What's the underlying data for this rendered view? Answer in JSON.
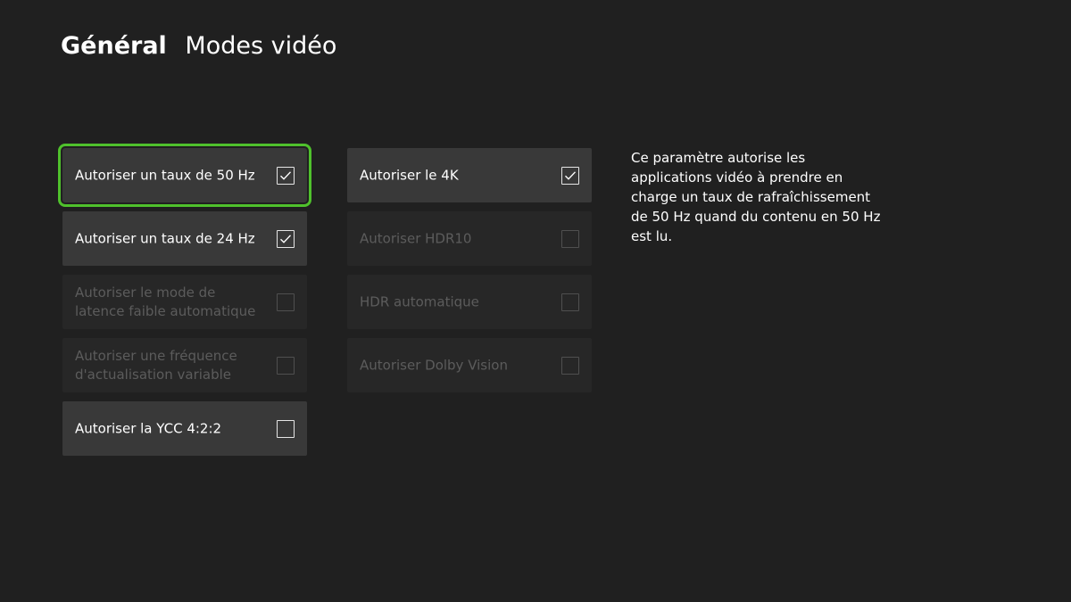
{
  "header": {
    "section": "Général",
    "page_title": "Modes vidéo"
  },
  "options": {
    "hz50": {
      "label": "Autoriser un taux de 50 Hz",
      "checked": true,
      "enabled": true,
      "focused": true
    },
    "hz24": {
      "label": "Autoriser un taux de 24 Hz",
      "checked": true,
      "enabled": true
    },
    "allm": {
      "label": "Autoriser le mode de latence faible automatique",
      "checked": false,
      "enabled": false
    },
    "vrr": {
      "label": "Autoriser une fréquence d'actualisation variable",
      "checked": false,
      "enabled": false
    },
    "ycc": {
      "label": "Autoriser la YCC 4:2:2",
      "checked": false,
      "enabled": true
    },
    "k4": {
      "label": "Autoriser le 4K",
      "checked": true,
      "enabled": true
    },
    "hdr10": {
      "label": "Autoriser HDR10",
      "checked": false,
      "enabled": false
    },
    "autohdr": {
      "label": "HDR automatique",
      "checked": false,
      "enabled": false
    },
    "dolby": {
      "label": "Autoriser Dolby Vision",
      "checked": false,
      "enabled": false
    }
  },
  "description": "Ce paramètre autorise les applications vidéo à prendre en charge un taux de rafraîchissement de 50 Hz quand du contenu en 50 Hz est lu.",
  "colors": {
    "background": "#202020",
    "tile": "#393939",
    "tile_disabled": "#272727",
    "focus": "#4fc12c",
    "text": "#ffffff",
    "text_disabled": "#5c5c5c"
  }
}
